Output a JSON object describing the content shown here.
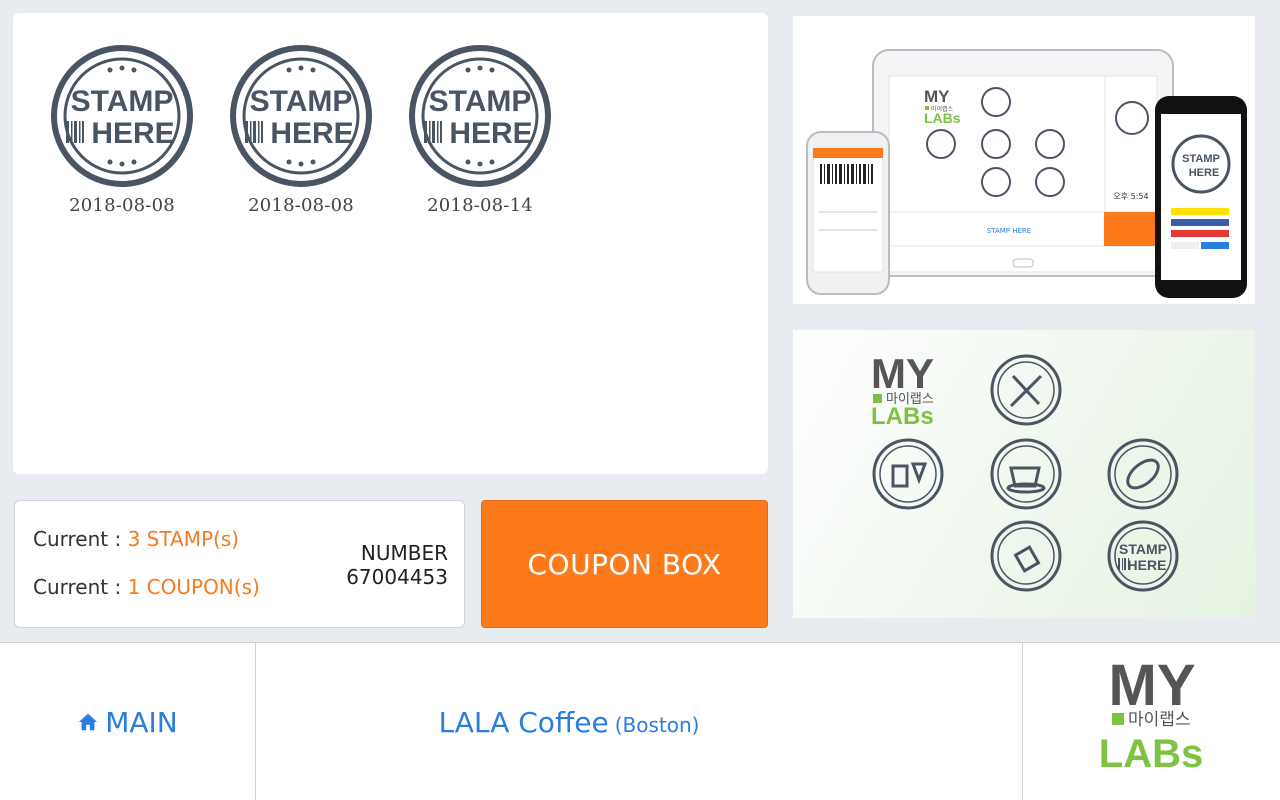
{
  "stamps": [
    {
      "label_top": "STAMP",
      "label_bottom": "HERE",
      "date": "2018-08-08"
    },
    {
      "label_top": "STAMP",
      "label_bottom": "HERE",
      "date": "2018-08-08"
    },
    {
      "label_top": "STAMP",
      "label_bottom": "HERE",
      "date": "2018-08-14"
    }
  ],
  "status": {
    "stamp_prefix": "Current : ",
    "stamp_value": "3 STAMP(s)",
    "coupon_prefix": "Current : ",
    "coupon_value": "1 COUPON(s)",
    "number_label": "NUMBER",
    "number_value": "67004453"
  },
  "coupon_button": {
    "label": "COUPON BOX"
  },
  "promo": {
    "logo_my": "MY",
    "logo_korean": "마이랩스",
    "logo_labs": "LABs",
    "stamp_top": "STAMP",
    "stamp_bottom": "HERE",
    "tablet_menu_stamp": "STAMP HERE",
    "tablet_time": "오후 5:54"
  },
  "bottom_nav": {
    "main_label": "MAIN",
    "store_name": "LALA Coffee",
    "store_location": "(Boston)"
  },
  "brand": {
    "logo_my": "MY",
    "logo_korean": "마이랩스",
    "logo_labs": "LABs"
  },
  "colors": {
    "accent_orange": "#fd7a1a",
    "link_blue": "#2a7de1",
    "stamp_gray": "#4a5563",
    "logo_gray": "#555555",
    "logo_green": "#7dc242"
  }
}
